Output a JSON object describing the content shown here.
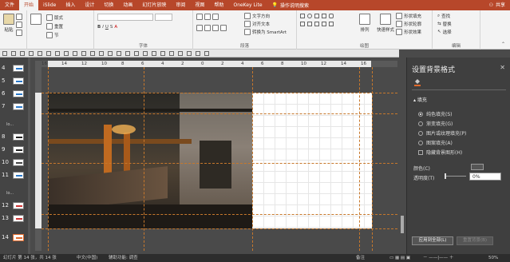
{
  "menu": {
    "tabs": [
      "文件",
      "开始",
      "iSlide",
      "插入",
      "设计",
      "切换",
      "动画",
      "幻灯片放映",
      "审阅",
      "视图",
      "帮助",
      "OneKey Lite"
    ],
    "active_index": 1,
    "search": "操作说明搜索",
    "share": "共享"
  },
  "ribbon": {
    "paste": "粘贴",
    "cut": "剪切",
    "copy": "复制",
    "new_slide": "新建\n幻灯片",
    "layout": "版式",
    "reset": "重置",
    "section": "节",
    "groups": {
      "font": "字体",
      "paragraph": "段落",
      "drawing": "绘图",
      "editing": "编辑"
    },
    "text_direction": "文字方向",
    "align_text": "对齐文本",
    "smartart": "转换为 SmartArt",
    "arrange": "排列",
    "quick_styles": "快速样式",
    "shape_fill": "形状填充",
    "shape_outline": "形状轮廓",
    "shape_effects": "形状效果",
    "find": "查找",
    "replace": "替换",
    "select": "选择"
  },
  "ruler": {
    "h_ticks": [
      "16",
      "14",
      "12",
      "10",
      "8",
      "6",
      "4",
      "2",
      "0",
      "2",
      "4",
      "6",
      "8",
      "10",
      "12",
      "14",
      "16"
    ],
    "v_ticks": [
      "8",
      "6",
      "4",
      "2",
      "0",
      "2",
      "4",
      "6",
      "8"
    ]
  },
  "thumbnails": [
    {
      "num": "4",
      "bar": "#2a78c8"
    },
    {
      "num": "5",
      "bar": "#2a78c8"
    },
    {
      "num": "6",
      "bar": "#2a78c8"
    },
    {
      "num": "7",
      "bar": "#2a78c8"
    },
    {
      "num": "8",
      "bar": "#222222"
    },
    {
      "num": "9",
      "bar": "#222222"
    },
    {
      "num": "10",
      "bar": "#444444"
    },
    {
      "num": "11",
      "bar": "#2a78c8"
    },
    {
      "num": "12",
      "bar": "#cc3333"
    },
    {
      "num": "13",
      "bar": "#cc3333"
    },
    {
      "num": "14",
      "bar": "#e06a2b"
    }
  ],
  "thumb_sections": [
    "lo...",
    "lo..."
  ],
  "pane": {
    "title": "设置背景格式",
    "close": "✕",
    "section": "填充",
    "options": [
      {
        "label": "纯色填充(S)",
        "type": "radio",
        "on": true
      },
      {
        "label": "渐变填充(G)",
        "type": "radio",
        "on": false
      },
      {
        "label": "图片或纹理填充(P)",
        "type": "radio",
        "on": false
      },
      {
        "label": "图案填充(A)",
        "type": "radio",
        "on": false
      },
      {
        "label": "隐藏背景图形(H)",
        "type": "check",
        "on": false
      }
    ],
    "color_label": "颜色(C)",
    "transparency_label": "透明度(T)",
    "transparency_value": "0%",
    "apply_all": "应用到全部(L)",
    "reset_bg": "重置背景(B)"
  },
  "status": {
    "slide": "幻灯片 第 14 张，共 14 张",
    "lang": "中文(中国)",
    "accessibility": "辅助功能: 调查",
    "notes": "备注",
    "zoom": "50%"
  },
  "colors": {
    "brand": "#b7472a",
    "guide": "#c7782c"
  }
}
